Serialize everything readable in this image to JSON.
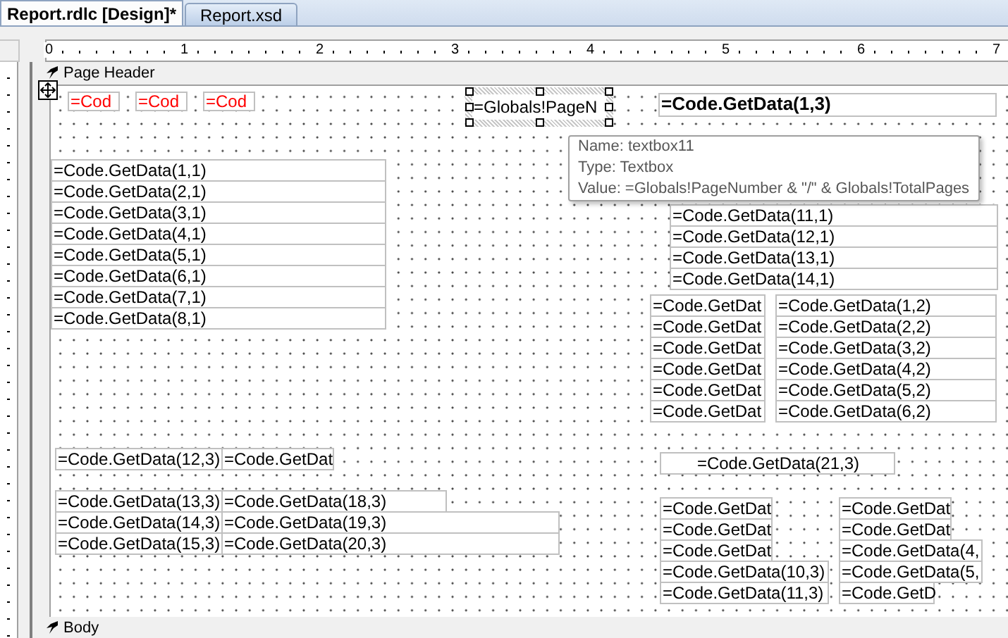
{
  "tabs": [
    {
      "label": "Report.rdlc [Design]*",
      "selected": true
    },
    {
      "label": "Report.xsd",
      "selected": false
    }
  ],
  "ruler": {
    "marks": [
      "0",
      "1",
      "2",
      "3",
      "4",
      "5",
      "6",
      "7"
    ]
  },
  "page_header": {
    "label": "Page Header"
  },
  "header_textboxes": [
    "=Cod",
    "=Cod",
    "=Cod"
  ],
  "page_number_textbox": {
    "text": "=Globals!PageN",
    "selected": true
  },
  "title_textbox": "=Code.GetData(1,3)",
  "tables": [
    {
      "rows": [
        [
          "=Code.GetData(1,1)"
        ],
        [
          "=Code.GetData(2,1)"
        ],
        [
          "=Code.GetData(3,1)"
        ],
        [
          "=Code.GetData(4,1)"
        ],
        [
          "=Code.GetData(5,1)"
        ],
        [
          "=Code.GetData(6,1)"
        ],
        [
          "=Code.GetData(7,1)"
        ],
        [
          "=Code.GetData(8,1)"
        ]
      ]
    },
    {
      "rows": [
        [
          "=Code.GetData(11,1)"
        ],
        [
          "=Code.GetData(12,1)"
        ],
        [
          "=Code.GetData(13,1)"
        ],
        [
          "=Code.GetData(14,1)"
        ]
      ]
    },
    {
      "rows": [
        [
          "=Code.GetDat",
          "=Code.GetData(1,2)"
        ],
        [
          "=Code.GetDat",
          "=Code.GetData(2,2)"
        ],
        [
          "=Code.GetDat",
          "=Code.GetData(3,2)"
        ],
        [
          "=Code.GetDat",
          "=Code.GetData(4,2)"
        ],
        [
          "=Code.GetDat",
          "=Code.GetData(5,2)"
        ],
        [
          "=Code.GetDat",
          "=Code.GetData(6,2)"
        ]
      ]
    },
    {
      "rows": [
        [
          "=Code.GetData(12,3)",
          "=Code.GetDat"
        ]
      ]
    },
    {
      "rows": [
        [
          "=Code.GetData(13,3)",
          "=Code.GetData(18,3)"
        ],
        [
          "=Code.GetData(14,3)",
          "=Code.GetData(19,3)"
        ],
        [
          "=Code.GetData(15,3)",
          "=Code.GetData(20,3)"
        ]
      ]
    },
    {
      "rows": [
        [
          "=Code.GetData(21,3)"
        ]
      ]
    },
    {
      "rows": [
        [
          "=Code.GetDat"
        ],
        [
          "=Code.GetDat"
        ],
        [
          "=Code.GetDat"
        ],
        [
          "=Code.GetData(10,3)"
        ],
        [
          "=Code.GetData(11,3)"
        ]
      ]
    },
    {
      "rows": [
        [
          "=Code.GetDat"
        ],
        [
          "=Code.GetDat"
        ],
        [
          "=Code.GetData(4,"
        ],
        [
          "=Code.GetData(5,"
        ],
        [
          "=Code.GetD"
        ]
      ]
    }
  ],
  "tooltip": {
    "lines": [
      "Name: textbox11",
      "Type: Textbox",
      "Value: =Globals!PageNumber & \"/\" & Globals!TotalPages"
    ]
  },
  "body": {
    "label": "Body"
  }
}
